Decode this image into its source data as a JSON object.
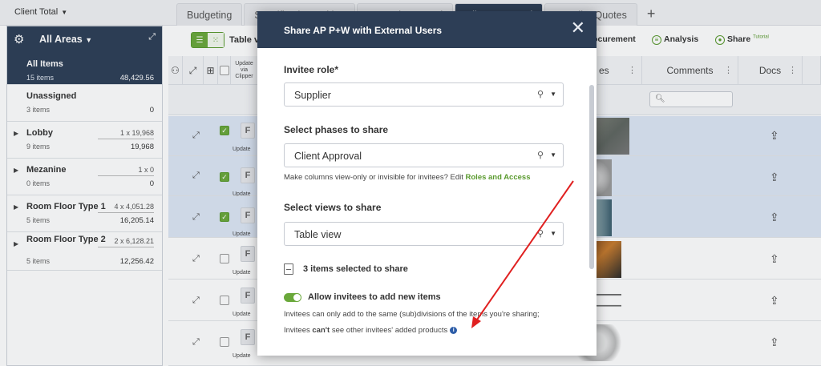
{
  "topbar": {
    "client_total": "Client Total",
    "tabs": [
      {
        "label": "Budgeting"
      },
      {
        "label": "Specification Writing"
      },
      {
        "label": "Internal Approval"
      },
      {
        "label": "Client Approval"
      },
      {
        "label": "Supplier Quotes"
      }
    ],
    "add_tab": "+"
  },
  "sidebar": {
    "header": "All Areas",
    "items": [
      {
        "name": "All Items",
        "count": "15 items",
        "dims": "",
        "total": "48,429.56"
      },
      {
        "name": "Unassigned",
        "count": "3 items",
        "dims": "",
        "total": "0"
      },
      {
        "name": "Lobby",
        "count": "9 items",
        "dims": "1 x 19,968",
        "total": "19,968"
      },
      {
        "name": "Mezanine",
        "count": "0 items",
        "dims": "1 x 0",
        "total": "0"
      },
      {
        "name": "Room Floor Type 1",
        "count": "5 items",
        "dims": "4 x 4,051.28",
        "total": "16,205.14"
      },
      {
        "name": "Room Floor Type 2",
        "count": "5 items",
        "dims": "2 x 6,128.21",
        "total": "12,256.42"
      }
    ]
  },
  "toolbar": {
    "view_label": "Table v",
    "procurement": "rocurement",
    "analysis": "Analysis",
    "share": "Share",
    "tutorial": "Tutorial"
  },
  "grid": {
    "col_update": "Update via Clipper",
    "col_images": "es",
    "col_comments": "Comments",
    "col_docs": "Docs",
    "update_label": "Update"
  },
  "modal": {
    "title": "Share AP P+W with External Users",
    "invitee_role_label": "Invitee role*",
    "invitee_role_value": "Supplier",
    "phases_label": "Select phases to share",
    "phases_value": "Client Approval",
    "phases_hint_prefix": "Make columns view-only or invisible for invitees? Edit ",
    "phases_hint_link": "Roles and Access",
    "views_label": "Select views to share",
    "views_value": "Table view",
    "items_selected": "3 items selected to share",
    "allow_label": "Allow invitees to add new items",
    "allow_hint_1": "Invitees can only add to the same (sub)divisions of the items you're sharing;",
    "allow_hint_2_prefix": "Invitees ",
    "allow_hint_2_bold": "can't",
    "allow_hint_2_suffix": " see other invitees' added products"
  },
  "colors": {
    "navy": "#2d3e56",
    "green": "#6aa83a",
    "selected_row": "#dde6f5",
    "annotation_red": "#e02020"
  }
}
